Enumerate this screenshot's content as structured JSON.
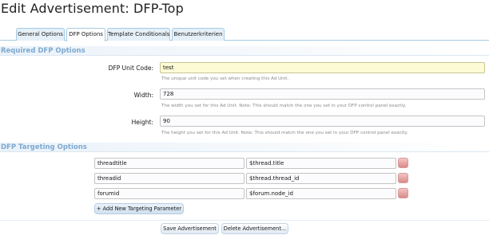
{
  "page": {
    "title": "Edit Advertisement: DFP-Top"
  },
  "tabs": [
    {
      "label": "General Options",
      "active": false
    },
    {
      "label": "DFP Options",
      "active": true
    },
    {
      "label": "Template Conditionals",
      "active": false
    },
    {
      "label": "Benutzerkriterien",
      "active": false
    }
  ],
  "required_section": {
    "title": "Required DFP Options",
    "unit_code": {
      "label": "DFP Unit Code:",
      "value": "test",
      "hint": "The unique unit code you set when creating this Ad Unit."
    },
    "width": {
      "label": "Width:",
      "value": "728",
      "hint": "The width you set for this Ad Unit. Note: This should match the one you set in your DFP control panel exactly."
    },
    "height": {
      "label": "Height:",
      "value": "90",
      "hint": "The height you set for this Ad Unit. Note: This should match the one you set in your DFP control panel exactly."
    }
  },
  "targeting_section": {
    "title": "DFP Targeting Options",
    "rows": [
      {
        "key": "threadtitle",
        "value": "$thread.title"
      },
      {
        "key": "threadid",
        "value": "$thread.thread_id"
      },
      {
        "key": "forumid",
        "value": "$forum.node_id"
      }
    ],
    "add_label": "+ Add New Targeting Parameter"
  },
  "actions": {
    "save_label": "Save Advertisement",
    "delete_label": "Delete Advertisement..."
  },
  "colors": {
    "section_title": "#7ea9d0",
    "tab_border": "#a5cae4",
    "highlight_input": "#fdfbd6",
    "delete_button": "#e8a5a5"
  }
}
